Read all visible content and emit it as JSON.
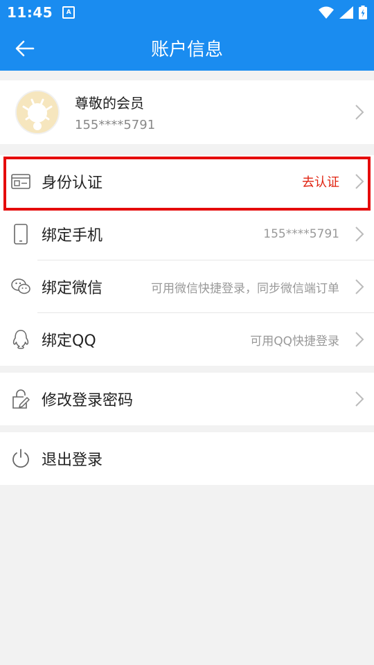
{
  "status_bar": {
    "time": "11:45",
    "notification_glyph": "A"
  },
  "app_bar": {
    "title": "账户信息"
  },
  "profile": {
    "name": "尊敬的会员",
    "phone": "155****5791"
  },
  "rows": {
    "identity": {
      "label": "身份认证",
      "value": "去认证"
    },
    "phone": {
      "label": "绑定手机",
      "value": "155****5791"
    },
    "wechat": {
      "label": "绑定微信",
      "value": "可用微信快捷登录，同步微信端订单"
    },
    "qq": {
      "label": "绑定QQ",
      "value": "可用QQ快捷登录"
    },
    "password": {
      "label": "修改登录密码"
    },
    "logout": {
      "label": "退出登录"
    }
  },
  "colors": {
    "primary": "#1a8cf0",
    "alert": "#e0220f",
    "highlight_border": "#e50b0b"
  }
}
